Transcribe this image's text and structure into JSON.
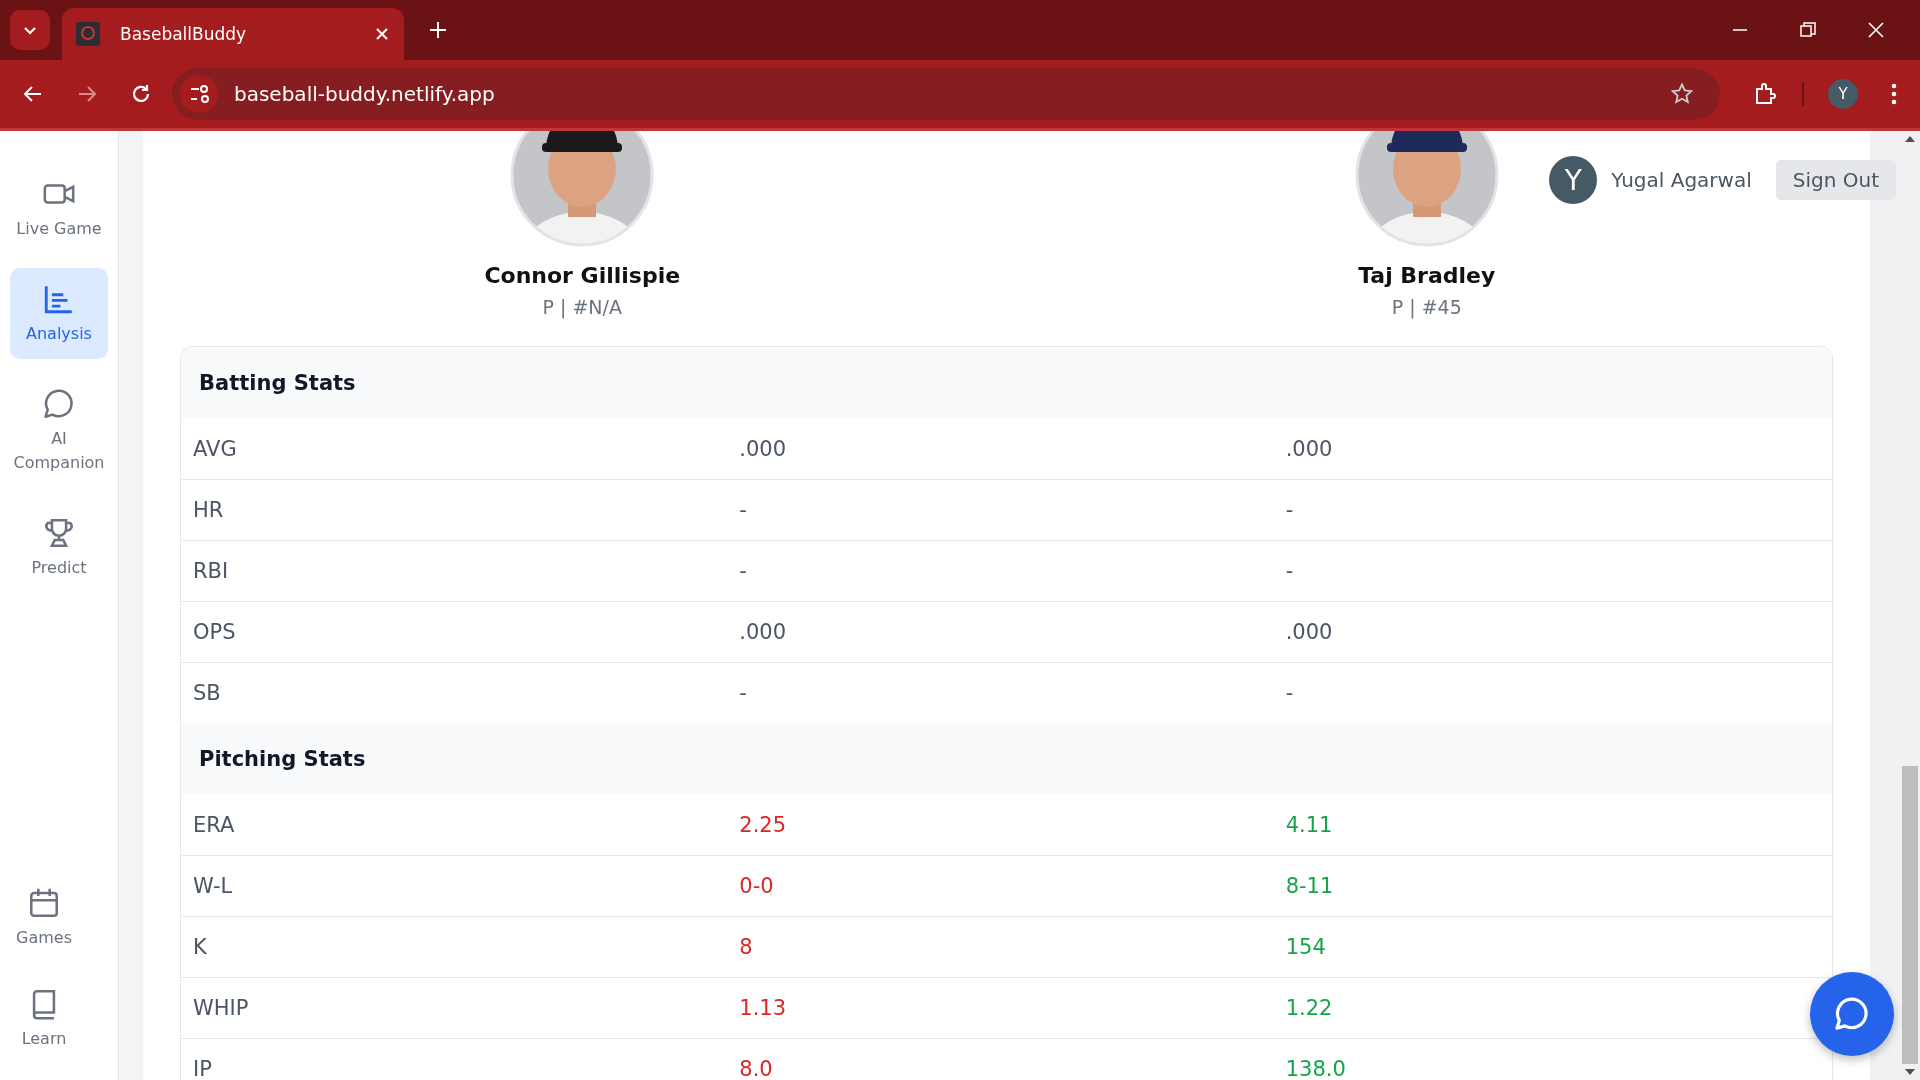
{
  "browser": {
    "tab_title": "BaseballBuddy",
    "address": "baseball-buddy.netlify.app",
    "profile_initial": "Y"
  },
  "sidebar": {
    "items": [
      {
        "label": "Live Game",
        "kind": "video",
        "selected": false
      },
      {
        "label": "Analysis",
        "kind": "chart",
        "selected": true
      },
      {
        "label": "AI Companion",
        "kind": "chat",
        "selected": false
      },
      {
        "label": "Predict",
        "kind": "trophy",
        "selected": false
      }
    ],
    "bottom_items": [
      {
        "label": "Games",
        "kind": "calendar",
        "selected": false
      },
      {
        "label": "Learn",
        "kind": "book",
        "selected": false
      }
    ]
  },
  "user": {
    "initial": "Y",
    "name": "Yugal Agarwal",
    "sign_out": "Sign Out"
  },
  "players": [
    {
      "name": "Connor Gillispie",
      "info": "P | #N/A"
    },
    {
      "name": "Taj Bradley",
      "info": "P | #45"
    }
  ],
  "sections": [
    {
      "title": "Batting Stats",
      "rows": [
        {
          "stat": "AVG",
          "values": [
            {
              "text": ".000",
              "color": "#4b5563"
            },
            {
              "text": ".000",
              "color": "#4b5563"
            }
          ]
        },
        {
          "stat": "HR",
          "values": [
            {
              "text": "-",
              "color": "#4b5563"
            },
            {
              "text": "-",
              "color": "#4b5563"
            }
          ]
        },
        {
          "stat": "RBI",
          "values": [
            {
              "text": "-",
              "color": "#4b5563"
            },
            {
              "text": "-",
              "color": "#4b5563"
            }
          ]
        },
        {
          "stat": "OPS",
          "values": [
            {
              "text": ".000",
              "color": "#4b5563"
            },
            {
              "text": ".000",
              "color": "#4b5563"
            }
          ]
        },
        {
          "stat": "SB",
          "values": [
            {
              "text": "-",
              "color": "#4b5563"
            },
            {
              "text": "-",
              "color": "#4b5563"
            }
          ]
        }
      ]
    },
    {
      "title": "Pitching Stats",
      "rows": [
        {
          "stat": "ERA",
          "values": [
            {
              "text": "2.25",
              "color": "#dc2626"
            },
            {
              "text": "4.11",
              "color": "#16a34a"
            }
          ]
        },
        {
          "stat": "W-L",
          "values": [
            {
              "text": "0-0",
              "color": "#dc2626"
            },
            {
              "text": "8-11",
              "color": "#16a34a"
            }
          ]
        },
        {
          "stat": "K",
          "values": [
            {
              "text": "8",
              "color": "#dc2626"
            },
            {
              "text": "154",
              "color": "#16a34a"
            }
          ]
        },
        {
          "stat": "WHIP",
          "values": [
            {
              "text": "1.13",
              "color": "#dc2626"
            },
            {
              "text": "1.22",
              "color": "#16a34a"
            }
          ]
        },
        {
          "stat": "IP",
          "values": [
            {
              "text": "8.0",
              "color": "#dc2626"
            },
            {
              "text": "138.0",
              "color": "#16a34a"
            }
          ]
        }
      ]
    }
  ]
}
